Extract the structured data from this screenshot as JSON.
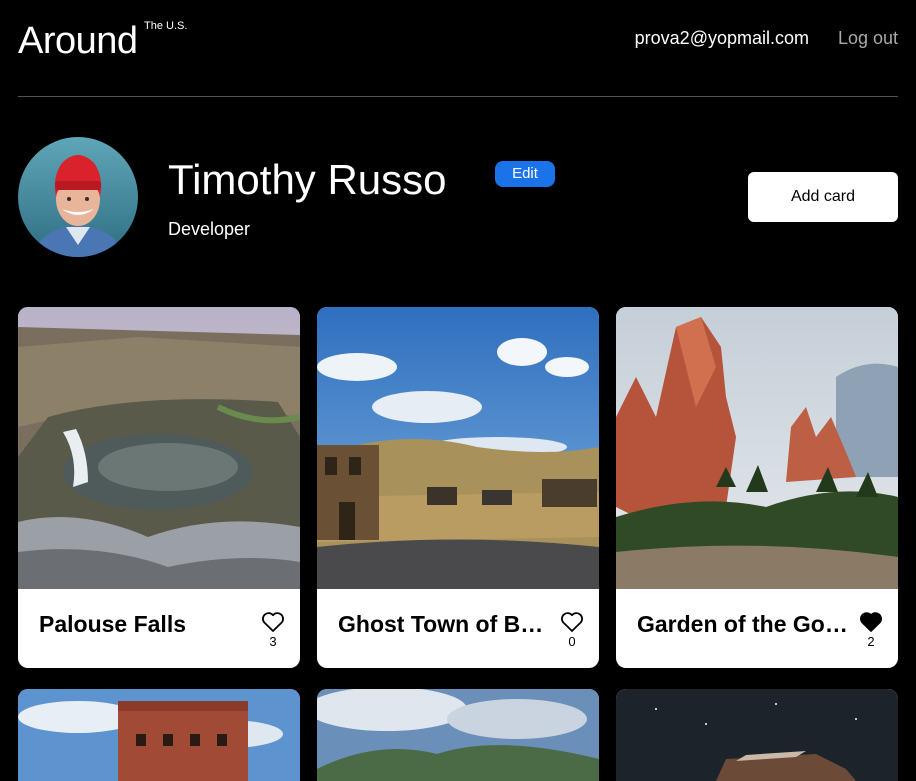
{
  "header": {
    "logo": "Around",
    "logo_sup": "The U.S.",
    "email": "prova2@yopmail.com",
    "logout": "Log out"
  },
  "profile": {
    "name": "Timothy Russo",
    "edit_label": "Edit",
    "job": "Developer",
    "add_card_label": "Add card"
  },
  "cards": [
    {
      "title": "Palouse Falls",
      "likes": "3",
      "liked": false
    },
    {
      "title": "Ghost Town of B…",
      "likes": "0",
      "liked": false
    },
    {
      "title": "Garden of the Go…",
      "likes": "2",
      "liked": true
    }
  ],
  "colors": {
    "background": "#000000",
    "accent": "#1a73e8",
    "divider": "#545454",
    "muted_text": "#a9a9a9"
  },
  "icons": {
    "like_empty": "heart-outline-icon",
    "like_filled": "heart-filled-icon"
  }
}
